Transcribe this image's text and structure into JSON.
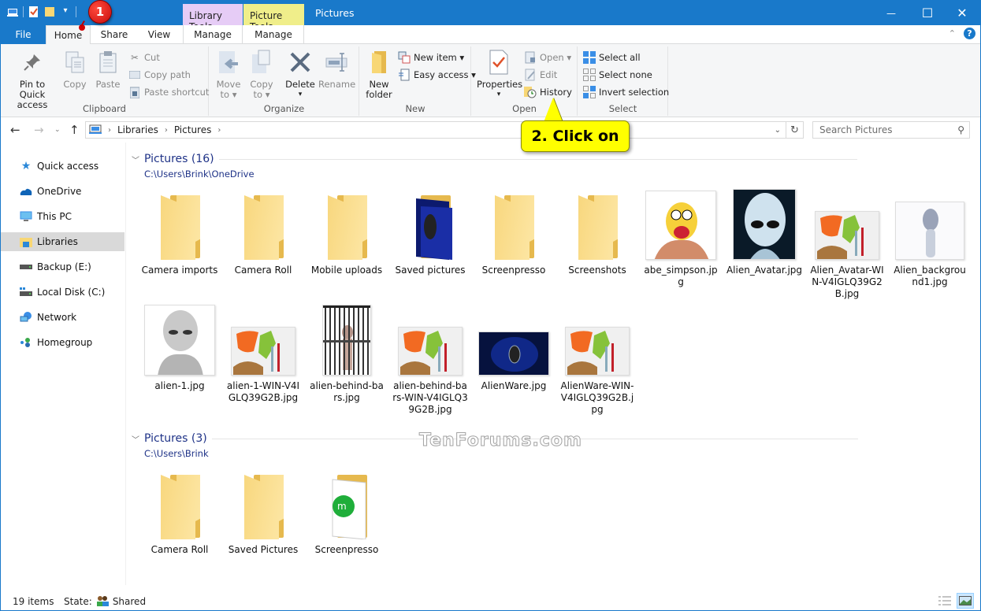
{
  "window": {
    "title": "Pictures",
    "context_tabs": [
      "Library Tools",
      "Picture Tools"
    ],
    "controls": {
      "minimize": "—",
      "maximize": "☐",
      "close": "✕"
    }
  },
  "tabs": [
    "File",
    "Home",
    "Share",
    "View",
    "Manage",
    "Manage"
  ],
  "ribbon": {
    "clipboard": {
      "label": "Clipboard",
      "pin": "Pin to Quick access",
      "pin_l1": "Pin to Quick",
      "pin_l2": "access",
      "copy": "Copy",
      "paste": "Paste",
      "cut": "Cut",
      "copy_path": "Copy path",
      "paste_shortcut": "Paste shortcut"
    },
    "organize": {
      "label": "Organize",
      "move_l1": "Move",
      "move_l2": "to ▾",
      "copy_l1": "Copy",
      "copy_l2": "to ▾",
      "delete": "Delete",
      "delete_arrow": "▾",
      "rename": "Rename"
    },
    "new": {
      "label": "New",
      "folder_l1": "New",
      "folder_l2": "folder",
      "new_item": "New item ▾",
      "easy_access": "Easy access ▾"
    },
    "open": {
      "label": "Open",
      "properties": "Properties",
      "properties_arrow": "▾",
      "open": "Open ▾",
      "edit": "Edit",
      "history": "History"
    },
    "select": {
      "label": "Select",
      "select_all": "Select all",
      "select_none": "Select none",
      "invert": "Invert selection"
    }
  },
  "address": {
    "crumbs": [
      "Libraries",
      "Pictures"
    ],
    "search_placeholder": "Search Pictures"
  },
  "sidebar": [
    {
      "label": "Quick access",
      "icon": "star-icon"
    },
    {
      "label": "OneDrive",
      "icon": "cloud-icon"
    },
    {
      "label": "This PC",
      "icon": "monitor-icon"
    },
    {
      "label": "Libraries",
      "icon": "library-icon",
      "selected": true
    },
    {
      "label": "Backup (E:)",
      "icon": "drive-icon"
    },
    {
      "label": "Local Disk (C:)",
      "icon": "system-drive-icon"
    },
    {
      "label": "Network",
      "icon": "network-icon"
    },
    {
      "label": "Homegroup",
      "icon": "homegroup-icon"
    }
  ],
  "groups": [
    {
      "title": "Pictures (16)",
      "path": "C:\\Users\\Brink\\OneDrive",
      "items": [
        {
          "name": "Camera imports",
          "type": "folder"
        },
        {
          "name": "Camera Roll",
          "type": "folder"
        },
        {
          "name": "Mobile uploads",
          "type": "folder"
        },
        {
          "name": "Saved pictures",
          "type": "folder-photo"
        },
        {
          "name": "Screenpresso",
          "type": "folder"
        },
        {
          "name": "Screenshots",
          "type": "folder"
        },
        {
          "name": "abe_simpson.jpg",
          "type": "image-cartoon"
        },
        {
          "name": "Alien_Avatar.jpg",
          "type": "image-alien"
        },
        {
          "name": "Alien_Avatar-WIN-V4IGLQ39G2B.jpg",
          "type": "image-paint"
        },
        {
          "name": "Alien_background1.jpg",
          "type": "image-alien-light"
        },
        {
          "name": "alien-1.jpg",
          "type": "image-alien-bust"
        },
        {
          "name": "alien-1-WIN-V4IGLQ39G2B.jpg",
          "type": "image-paint"
        },
        {
          "name": "alien-behind-bars.jpg",
          "type": "image-bars"
        },
        {
          "name": "alien-behind-bars-WIN-V4IGLQ39G2B.jpg",
          "type": "image-paint"
        },
        {
          "name": "AlienWare.jpg",
          "type": "image-alienware"
        },
        {
          "name": "AlienWare-WIN-V4IGLQ39G2B.jpg",
          "type": "image-paint"
        }
      ]
    },
    {
      "title": "Pictures (3)",
      "path": "C:\\Users\\Brink",
      "items": [
        {
          "name": "Camera Roll",
          "type": "folder"
        },
        {
          "name": "Saved Pictures",
          "type": "folder"
        },
        {
          "name": "Screenpresso",
          "type": "folder-doc"
        }
      ]
    }
  ],
  "status": {
    "count": "19 items",
    "state_label": "State:",
    "state_value": "Shared"
  },
  "annotations": {
    "step1": "1",
    "step2": "2. Click on",
    "watermark": "TenForums.com"
  }
}
